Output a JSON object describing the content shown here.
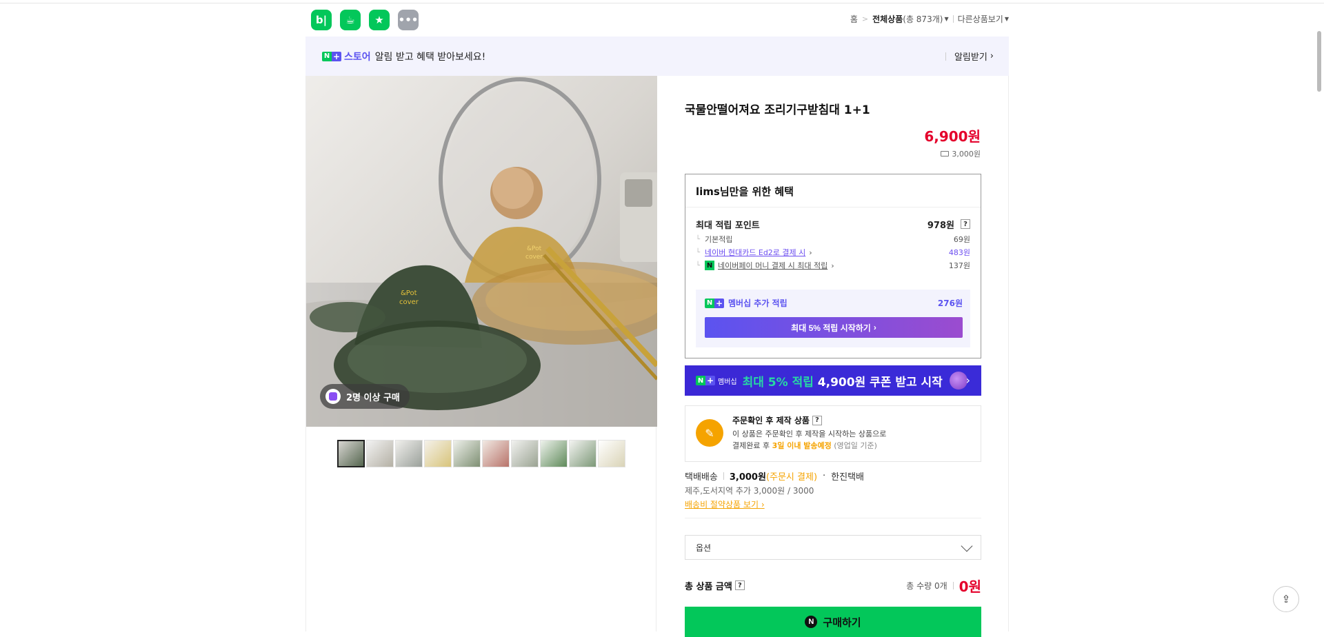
{
  "header": {
    "app_icons": [
      {
        "label": "b|",
        "name": "blog-app-icon"
      },
      {
        "label": "☕",
        "name": "cafe-app-icon"
      },
      {
        "label": "★",
        "name": "bookmark-app-icon"
      },
      {
        "label": "•••",
        "name": "more-apps-icon"
      }
    ],
    "breadcrumb": {
      "home": "홈",
      "all_products": "전체상품",
      "count": "(총 873개)",
      "other": "다른상품보기"
    }
  },
  "notice": {
    "store_label": "스토어",
    "text": "알림 받고 혜택 받아보세요!",
    "action": "알림받기"
  },
  "gallery": {
    "badge": "2명 이상 구매",
    "thumbnails": 10
  },
  "product": {
    "title": "국물안떨어져요 조리기구받침대 1+1",
    "price": "6,900원",
    "shipping_fee": "3,000원"
  },
  "benefit": {
    "title": "lims님만을 위한 혜택",
    "max_points_label": "최대 적립 포인트",
    "max_points_value": "978원",
    "rows": [
      {
        "label": "기본적립",
        "value": "69원"
      },
      {
        "label": "네이버 현대카드 Ed2로 결제 시",
        "value": "483원"
      },
      {
        "label": "네이버페이 머니 결제 시 최대 적립",
        "value": "137원"
      }
    ],
    "membership_label": "멤버십 추가 적립",
    "membership_value": "276원",
    "membership_button": "최대 5% 적립 시작하기"
  },
  "banner": {
    "tag": "멤버십",
    "text_green": "최대 5% 적립",
    "text_white": "4,900원 쿠폰 받고 시작"
  },
  "made_to_order": {
    "title": "주문확인 후 제작 상품",
    "line1": "이 상품은 주문확인 후 제작을 시작하는 상품으로",
    "line2_pre": "결제완료 후",
    "line2_highlight": "3일 이내 발송예정",
    "line2_post": "(영업일 기준)"
  },
  "delivery": {
    "method": "택배배송",
    "fee": "3,000원",
    "fee_note": "(주문시 결제)",
    "carrier": "한진택배",
    "extra": "제주,도서지역 추가 3,000원 / 3000",
    "save_link": "배송비 절약상품 보기"
  },
  "option": {
    "placeholder": "옵션"
  },
  "total": {
    "label": "총 상품 금액",
    "qty": "총 수량 0개",
    "amount": "0원"
  },
  "buy": {
    "label": "구매하기"
  },
  "colors": {
    "naver_green": "#03c75a",
    "price_red": "#e4002b",
    "membership_purple": "#5b53f0",
    "accent_orange": "#f5a300"
  }
}
